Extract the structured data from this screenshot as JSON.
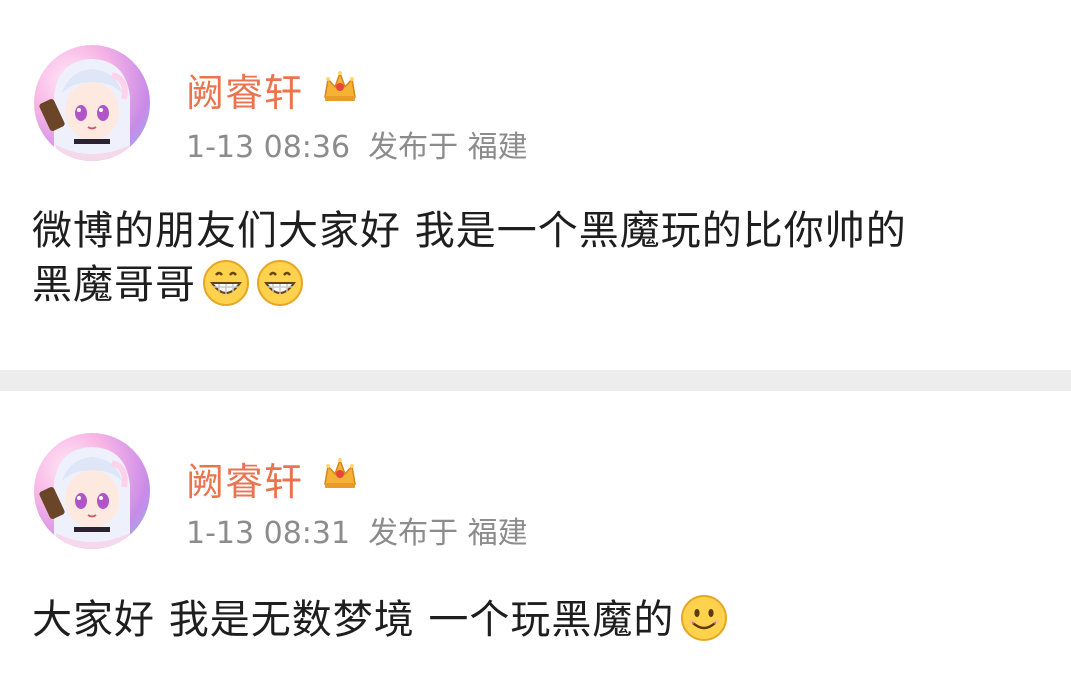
{
  "posts": [
    {
      "username": "阙睿轩",
      "badge_icon": "crown-icon",
      "time": "1-13 08:36",
      "location": "发布于 福建",
      "text_line1": "微博的朋友们大家好 我是一个黑魔玩的比你帅的",
      "text_line2": "黑魔哥哥",
      "emojis": [
        "grin-emoji",
        "grin-emoji"
      ]
    },
    {
      "username": "阙睿轩",
      "badge_icon": "crown-icon",
      "time": "1-13 08:31",
      "location": "发布于 福建",
      "text_line1": "大家好 我是无数梦境 一个玩黑魔的",
      "emojis": [
        "smile-emoji"
      ]
    }
  ],
  "colors": {
    "username": "#eb7350",
    "meta": "#8c8c8c",
    "text": "#1e1e1e",
    "divider": "#ededed"
  }
}
